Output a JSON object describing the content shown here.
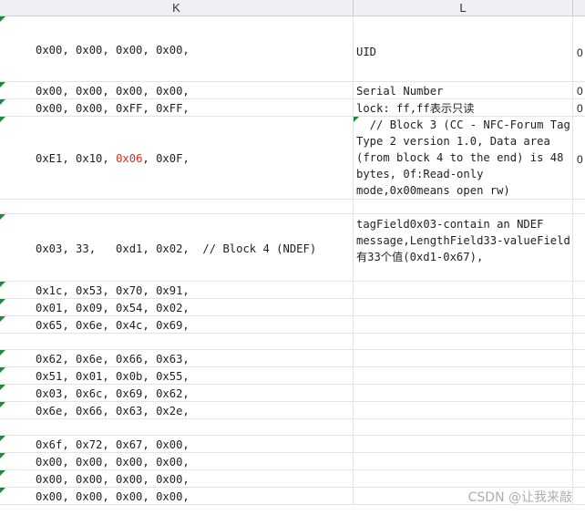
{
  "columns": {
    "k": "K",
    "l": "L"
  },
  "rows": [
    {
      "k": "0x00, 0x00, 0x00, 0x00,",
      "l": "UID",
      "m": "0"
    },
    {
      "k": "0x00, 0x00, 0x00, 0x00,",
      "l": "Serial Number",
      "m": "0"
    },
    {
      "k": "0x00, 0x00, 0xFF, 0xFF,",
      "l": "lock: ff,ff表示只读",
      "m": "0"
    },
    {
      "k_parts": [
        "0xE1, 0x10, ",
        "0x06",
        ", 0x0F,"
      ],
      "l": "  // Block 3 (CC - NFC-Forum Tag Type 2 version 1.0, Data area (from block 4 to the end) is 48 bytes, 0f:Read-only mode,0x00means open rw)",
      "m": "0"
    },
    {
      "k": "",
      "l": ""
    },
    {
      "k": "0x03, 33,   0xd1, 0x02,  // Block 4 (NDEF)",
      "l": "tagField0x03-contain an NDEF message,LengthField33-valueField 有33个值(0xd1-0x67),",
      "m": ""
    },
    {
      "k": "0x1c, 0x53, 0x70, 0x91,",
      "l": ""
    },
    {
      "k": "0x01, 0x09, 0x54, 0x02,",
      "l": ""
    },
    {
      "k": "0x65, 0x6e, 0x4c, 0x69,",
      "l": ""
    },
    {
      "k": "",
      "l": ""
    },
    {
      "k": "0x62, 0x6e, 0x66, 0x63,",
      "l": ""
    },
    {
      "k": "0x51, 0x01, 0x0b, 0x55,",
      "l": ""
    },
    {
      "k": "0x03, 0x6c, 0x69, 0x62,",
      "l": ""
    },
    {
      "k": "0x6e, 0x66, 0x63, 0x2e,",
      "l": ""
    },
    {
      "k": "",
      "l": ""
    },
    {
      "k": "0x6f, 0x72, 0x67, 0x00,",
      "l": ""
    },
    {
      "k": "0x00, 0x00, 0x00, 0x00,",
      "l": ""
    },
    {
      "k": "0x00, 0x00, 0x00, 0x00,",
      "l": ""
    },
    {
      "k": "0x00, 0x00, 0x00, 0x00,",
      "l": ""
    }
  ],
  "highlight_color": "#e8261b",
  "flag_color": "#1f8a3b",
  "watermark": "CSDN @让我来敲"
}
